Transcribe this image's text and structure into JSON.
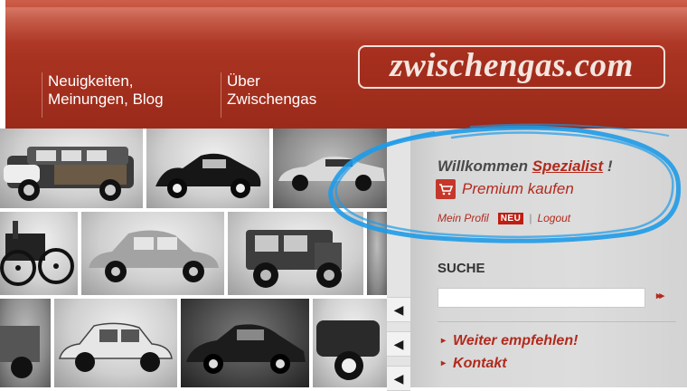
{
  "header": {
    "nav": [
      {
        "label": "Neuigkeiten,\nMeinungen, Blog"
      },
      {
        "label": "Über\nZwischengas"
      }
    ],
    "logo_text": "zwischengas.com"
  },
  "gallery": {
    "arrow_glyph": "◀"
  },
  "sidebar": {
    "welcome_prefix": "Willkommen",
    "welcome_name": "Spezialist",
    "welcome_suffix": "!",
    "premium_label": "Premium kaufen",
    "premium_icon": "shopping-cart-icon",
    "profile_link": "Mein Profil",
    "new_badge": "NEU",
    "separator": "|",
    "logout_link": "Logout",
    "search_title": "SUCHE",
    "search_value": "",
    "search_go": "▸▸",
    "links": [
      {
        "label": "Weiter empfehlen!"
      },
      {
        "label": "Kontakt"
      }
    ],
    "link_glyph": "▸"
  },
  "colors": {
    "header_red": "#a93321",
    "accent_red": "#b22a1d",
    "highlight_blue": "#1e9be8",
    "sidebar_gray": "#dddddd"
  }
}
